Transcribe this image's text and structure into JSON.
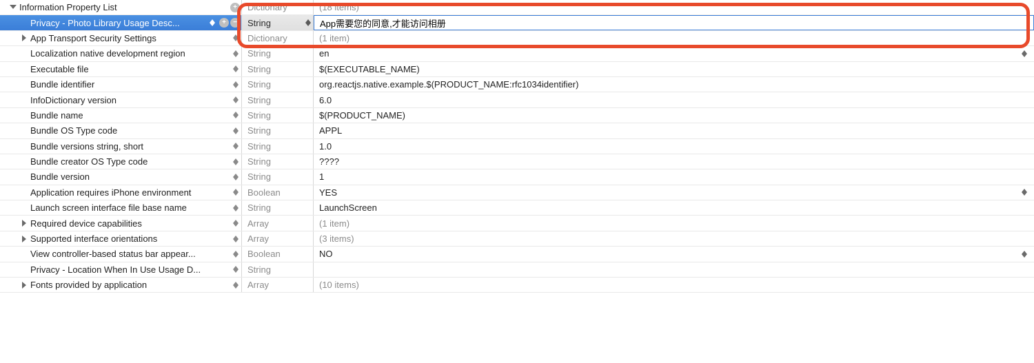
{
  "root": {
    "key": "Information Property List",
    "type": "Dictionary",
    "value": "(18 items)"
  },
  "selected": {
    "key": "Privacy - Photo Library Usage Desc...",
    "type": "String",
    "value": "App需要您的同意,才能访问相册"
  },
  "rows": [
    {
      "key": "App Transport Security Settings",
      "type": "Dictionary",
      "value": "(1 item)",
      "expandable": true,
      "grey": true,
      "valueStepper": false
    },
    {
      "key": "Localization native development region",
      "type": "String",
      "value": "en",
      "expandable": false,
      "grey": false,
      "valueStepper": true
    },
    {
      "key": "Executable file",
      "type": "String",
      "value": "$(EXECUTABLE_NAME)",
      "expandable": false,
      "grey": false,
      "valueStepper": false
    },
    {
      "key": "Bundle identifier",
      "type": "String",
      "value": "org.reactjs.native.example.$(PRODUCT_NAME:rfc1034identifier)",
      "expandable": false,
      "grey": false,
      "valueStepper": false
    },
    {
      "key": "InfoDictionary version",
      "type": "String",
      "value": "6.0",
      "expandable": false,
      "grey": false,
      "valueStepper": false
    },
    {
      "key": "Bundle name",
      "type": "String",
      "value": "$(PRODUCT_NAME)",
      "expandable": false,
      "grey": false,
      "valueStepper": false
    },
    {
      "key": "Bundle OS Type code",
      "type": "String",
      "value": "APPL",
      "expandable": false,
      "grey": false,
      "valueStepper": false
    },
    {
      "key": "Bundle versions string, short",
      "type": "String",
      "value": "1.0",
      "expandable": false,
      "grey": false,
      "valueStepper": false
    },
    {
      "key": "Bundle creator OS Type code",
      "type": "String",
      "value": "????",
      "expandable": false,
      "grey": false,
      "valueStepper": false
    },
    {
      "key": "Bundle version",
      "type": "String",
      "value": "1",
      "expandable": false,
      "grey": false,
      "valueStepper": false
    },
    {
      "key": "Application requires iPhone environment",
      "type": "Boolean",
      "value": "YES",
      "expandable": false,
      "grey": false,
      "valueStepper": true
    },
    {
      "key": "Launch screen interface file base name",
      "type": "String",
      "value": "LaunchScreen",
      "expandable": false,
      "grey": false,
      "valueStepper": false
    },
    {
      "key": "Required device capabilities",
      "type": "Array",
      "value": "(1 item)",
      "expandable": true,
      "grey": true,
      "valueStepper": false
    },
    {
      "key": "Supported interface orientations",
      "type": "Array",
      "value": "(3 items)",
      "expandable": true,
      "grey": true,
      "valueStepper": false
    },
    {
      "key": "View controller-based status bar appear...",
      "type": "Boolean",
      "value": "NO",
      "expandable": false,
      "grey": false,
      "valueStepper": true
    },
    {
      "key": "Privacy - Location When In Use Usage D...",
      "type": "String",
      "value": "",
      "expandable": false,
      "grey": false,
      "valueStepper": false
    },
    {
      "key": "Fonts provided by application",
      "type": "Array",
      "value": "(10 items)",
      "expandable": true,
      "grey": true,
      "valueStepper": false
    }
  ]
}
